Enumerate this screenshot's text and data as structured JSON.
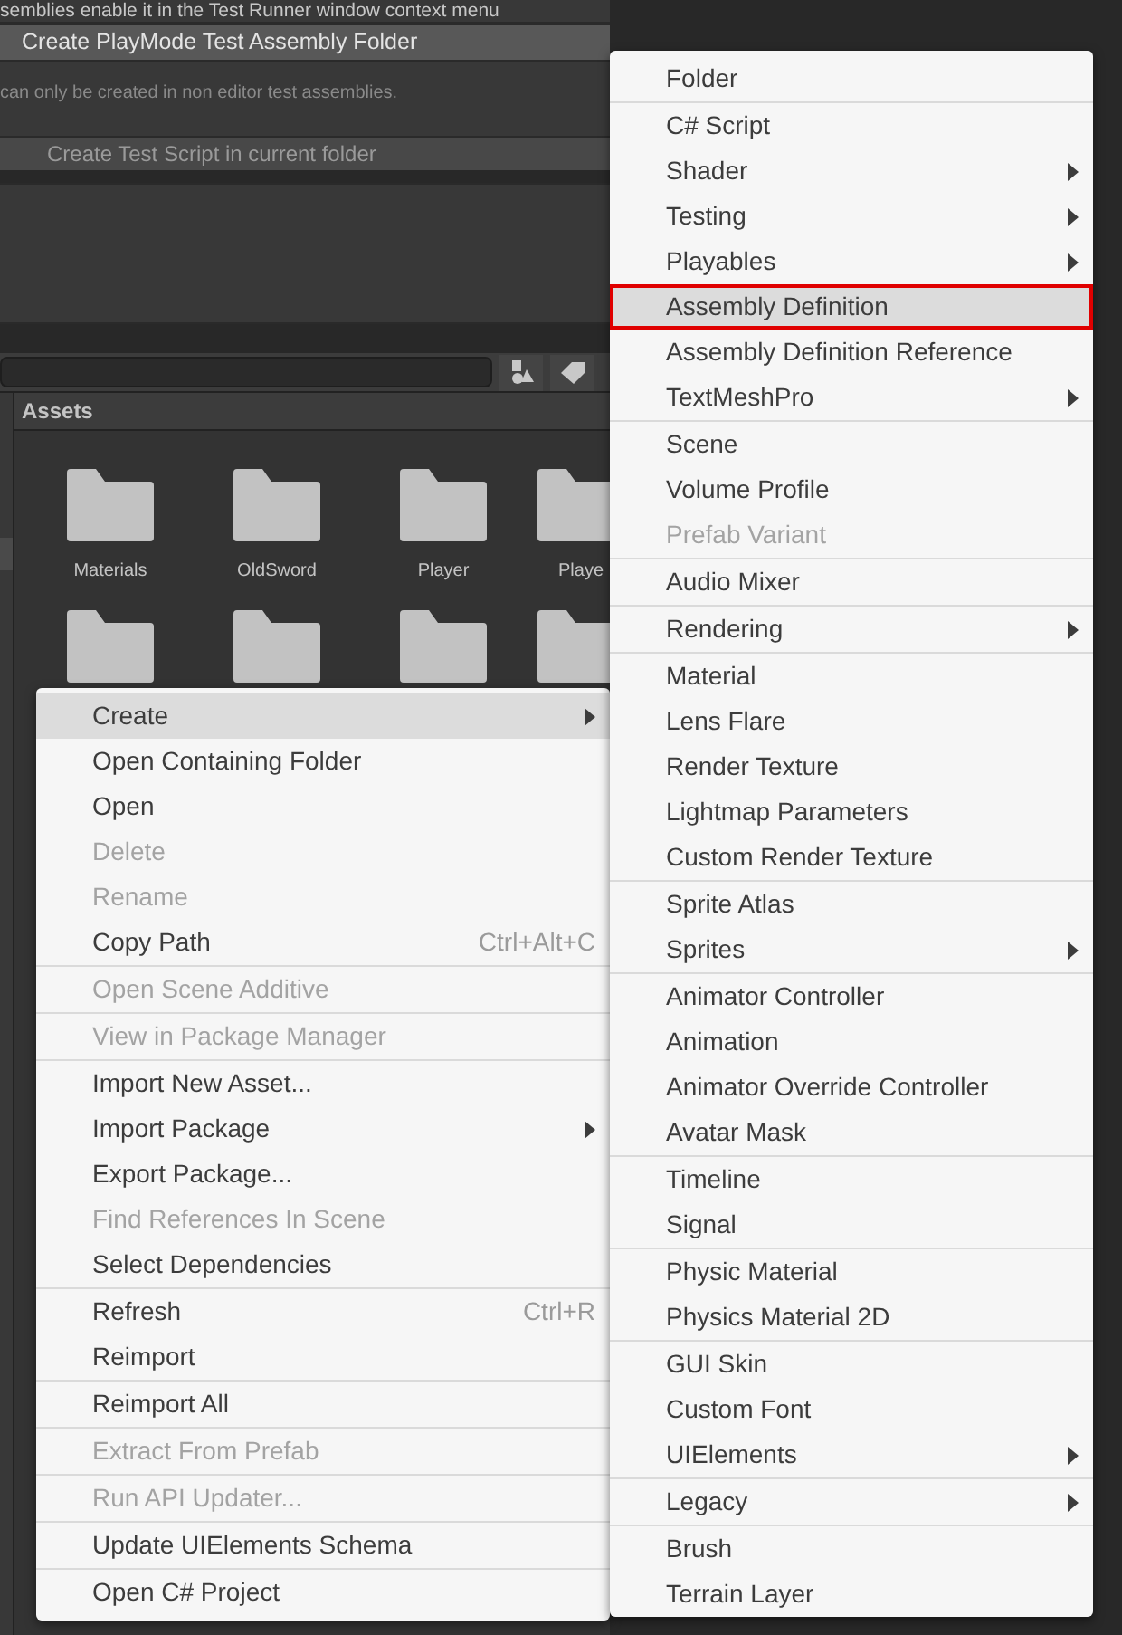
{
  "test_runner": {
    "info_text": "semblies enable it in the Test Runner window context menu",
    "playmode_button": {
      "label": "Create PlayMode Test Assembly Folder",
      "disabled": false
    },
    "note": "can only be created in non editor test assemblies.",
    "script_button": {
      "label": "Create Test Script in current folder",
      "disabled": true
    }
  },
  "project_window": {
    "breadcrumb": "Assets",
    "folders": [
      {
        "kind": "folder",
        "label": "Materials"
      },
      {
        "kind": "folder",
        "label": "OldSword"
      },
      {
        "kind": "folder",
        "label": "Player"
      },
      {
        "kind": "folder",
        "label": "Playe"
      },
      {
        "kind": "folder"
      },
      {
        "kind": "folder"
      },
      {
        "kind": "folder"
      },
      {
        "kind": "folder"
      }
    ]
  },
  "context_menu": {
    "items": [
      {
        "kind": "item",
        "label": "Create",
        "submenu": true,
        "disabled": false,
        "selected": true
      },
      {
        "kind": "item",
        "label": "Open Containing Folder",
        "submenu": false,
        "disabled": false,
        "selected": false
      },
      {
        "kind": "item",
        "label": "Open",
        "submenu": false,
        "disabled": false,
        "selected": false
      },
      {
        "kind": "item",
        "label": "Delete",
        "submenu": false,
        "disabled": true,
        "selected": false
      },
      {
        "kind": "item",
        "label": "Rename",
        "submenu": false,
        "disabled": true,
        "selected": false
      },
      {
        "kind": "item",
        "label": "Copy Path",
        "shortcut": "Ctrl+Alt+C",
        "submenu": false,
        "disabled": false,
        "selected": false
      },
      {
        "kind": "separator"
      },
      {
        "kind": "item",
        "label": "Open Scene Additive",
        "submenu": false,
        "disabled": true,
        "selected": false
      },
      {
        "kind": "separator"
      },
      {
        "kind": "item",
        "label": "View in Package Manager",
        "submenu": false,
        "disabled": true,
        "selected": false
      },
      {
        "kind": "separator"
      },
      {
        "kind": "item",
        "label": "Import New Asset...",
        "submenu": false,
        "disabled": false,
        "selected": false
      },
      {
        "kind": "item",
        "label": "Import Package",
        "submenu": true,
        "disabled": false,
        "selected": false
      },
      {
        "kind": "item",
        "label": "Export Package...",
        "submenu": false,
        "disabled": false,
        "selected": false
      },
      {
        "kind": "item",
        "label": "Find References In Scene",
        "submenu": false,
        "disabled": true,
        "selected": false
      },
      {
        "kind": "item",
        "label": "Select Dependencies",
        "submenu": false,
        "disabled": false,
        "selected": false
      },
      {
        "kind": "separator"
      },
      {
        "kind": "item",
        "label": "Refresh",
        "shortcut": "Ctrl+R",
        "submenu": false,
        "disabled": false,
        "selected": false
      },
      {
        "kind": "item",
        "label": "Reimport",
        "submenu": false,
        "disabled": false,
        "selected": false
      },
      {
        "kind": "separator"
      },
      {
        "kind": "item",
        "label": "Reimport All",
        "submenu": false,
        "disabled": false,
        "selected": false
      },
      {
        "kind": "separator"
      },
      {
        "kind": "item",
        "label": "Extract From Prefab",
        "submenu": false,
        "disabled": true,
        "selected": false
      },
      {
        "kind": "separator"
      },
      {
        "kind": "item",
        "label": "Run API Updater...",
        "submenu": false,
        "disabled": true,
        "selected": false
      },
      {
        "kind": "separator"
      },
      {
        "kind": "item",
        "label": "Update UIElements Schema",
        "submenu": false,
        "disabled": false,
        "selected": false
      },
      {
        "kind": "separator"
      },
      {
        "kind": "item",
        "label": "Open C# Project",
        "submenu": false,
        "disabled": false,
        "selected": false
      }
    ]
  },
  "create_submenu": {
    "items": [
      {
        "kind": "item",
        "label": "Folder",
        "submenu": false,
        "disabled": false,
        "selected": false,
        "outlined": false
      },
      {
        "kind": "separator"
      },
      {
        "kind": "item",
        "label": "C# Script",
        "submenu": false,
        "disabled": false,
        "selected": false,
        "outlined": false
      },
      {
        "kind": "item",
        "label": "Shader",
        "submenu": true,
        "disabled": false,
        "selected": false,
        "outlined": false
      },
      {
        "kind": "item",
        "label": "Testing",
        "submenu": true,
        "disabled": false,
        "selected": false,
        "outlined": false
      },
      {
        "kind": "item",
        "label": "Playables",
        "submenu": true,
        "disabled": false,
        "selected": false,
        "outlined": false
      },
      {
        "kind": "item",
        "label": "Assembly Definition",
        "submenu": false,
        "disabled": false,
        "selected": true,
        "outlined": true
      },
      {
        "kind": "item",
        "label": "Assembly Definition Reference",
        "submenu": false,
        "disabled": false,
        "selected": false,
        "outlined": false
      },
      {
        "kind": "item",
        "label": "TextMeshPro",
        "submenu": true,
        "disabled": false,
        "selected": false,
        "outlined": false
      },
      {
        "kind": "separator"
      },
      {
        "kind": "item",
        "label": "Scene",
        "submenu": false,
        "disabled": false,
        "selected": false,
        "outlined": false
      },
      {
        "kind": "item",
        "label": "Volume Profile",
        "submenu": false,
        "disabled": false,
        "selected": false,
        "outlined": false
      },
      {
        "kind": "item",
        "label": "Prefab Variant",
        "submenu": false,
        "disabled": true,
        "selected": false,
        "outlined": false
      },
      {
        "kind": "separator"
      },
      {
        "kind": "item",
        "label": "Audio Mixer",
        "submenu": false,
        "disabled": false,
        "selected": false,
        "outlined": false
      },
      {
        "kind": "separator"
      },
      {
        "kind": "item",
        "label": "Rendering",
        "submenu": true,
        "disabled": false,
        "selected": false,
        "outlined": false
      },
      {
        "kind": "separator"
      },
      {
        "kind": "item",
        "label": "Material",
        "submenu": false,
        "disabled": false,
        "selected": false,
        "outlined": false
      },
      {
        "kind": "item",
        "label": "Lens Flare",
        "submenu": false,
        "disabled": false,
        "selected": false,
        "outlined": false
      },
      {
        "kind": "item",
        "label": "Render Texture",
        "submenu": false,
        "disabled": false,
        "selected": false,
        "outlined": false
      },
      {
        "kind": "item",
        "label": "Lightmap Parameters",
        "submenu": false,
        "disabled": false,
        "selected": false,
        "outlined": false
      },
      {
        "kind": "item",
        "label": "Custom Render Texture",
        "submenu": false,
        "disabled": false,
        "selected": false,
        "outlined": false
      },
      {
        "kind": "separator"
      },
      {
        "kind": "item",
        "label": "Sprite Atlas",
        "submenu": false,
        "disabled": false,
        "selected": false,
        "outlined": false
      },
      {
        "kind": "item",
        "label": "Sprites",
        "submenu": true,
        "disabled": false,
        "selected": false,
        "outlined": false
      },
      {
        "kind": "separator"
      },
      {
        "kind": "item",
        "label": "Animator Controller",
        "submenu": false,
        "disabled": false,
        "selected": false,
        "outlined": false
      },
      {
        "kind": "item",
        "label": "Animation",
        "submenu": false,
        "disabled": false,
        "selected": false,
        "outlined": false
      },
      {
        "kind": "item",
        "label": "Animator Override Controller",
        "submenu": false,
        "disabled": false,
        "selected": false,
        "outlined": false
      },
      {
        "kind": "item",
        "label": "Avatar Mask",
        "submenu": false,
        "disabled": false,
        "selected": false,
        "outlined": false
      },
      {
        "kind": "separator"
      },
      {
        "kind": "item",
        "label": "Timeline",
        "submenu": false,
        "disabled": false,
        "selected": false,
        "outlined": false
      },
      {
        "kind": "item",
        "label": "Signal",
        "submenu": false,
        "disabled": false,
        "selected": false,
        "outlined": false
      },
      {
        "kind": "separator"
      },
      {
        "kind": "item",
        "label": "Physic Material",
        "submenu": false,
        "disabled": false,
        "selected": false,
        "outlined": false
      },
      {
        "kind": "item",
        "label": "Physics Material 2D",
        "submenu": false,
        "disabled": false,
        "selected": false,
        "outlined": false
      },
      {
        "kind": "separator"
      },
      {
        "kind": "item",
        "label": "GUI Skin",
        "submenu": false,
        "disabled": false,
        "selected": false,
        "outlined": false
      },
      {
        "kind": "item",
        "label": "Custom Font",
        "submenu": false,
        "disabled": false,
        "selected": false,
        "outlined": false
      },
      {
        "kind": "item",
        "label": "UIElements",
        "submenu": true,
        "disabled": false,
        "selected": false,
        "outlined": false
      },
      {
        "kind": "separator"
      },
      {
        "kind": "item",
        "label": "Legacy",
        "submenu": true,
        "disabled": false,
        "selected": false,
        "outlined": false
      },
      {
        "kind": "separator"
      },
      {
        "kind": "item",
        "label": "Brush",
        "submenu": false,
        "disabled": false,
        "selected": false,
        "outlined": false
      },
      {
        "kind": "item",
        "label": "Terrain Layer",
        "submenu": false,
        "disabled": false,
        "selected": false,
        "outlined": false
      }
    ]
  }
}
